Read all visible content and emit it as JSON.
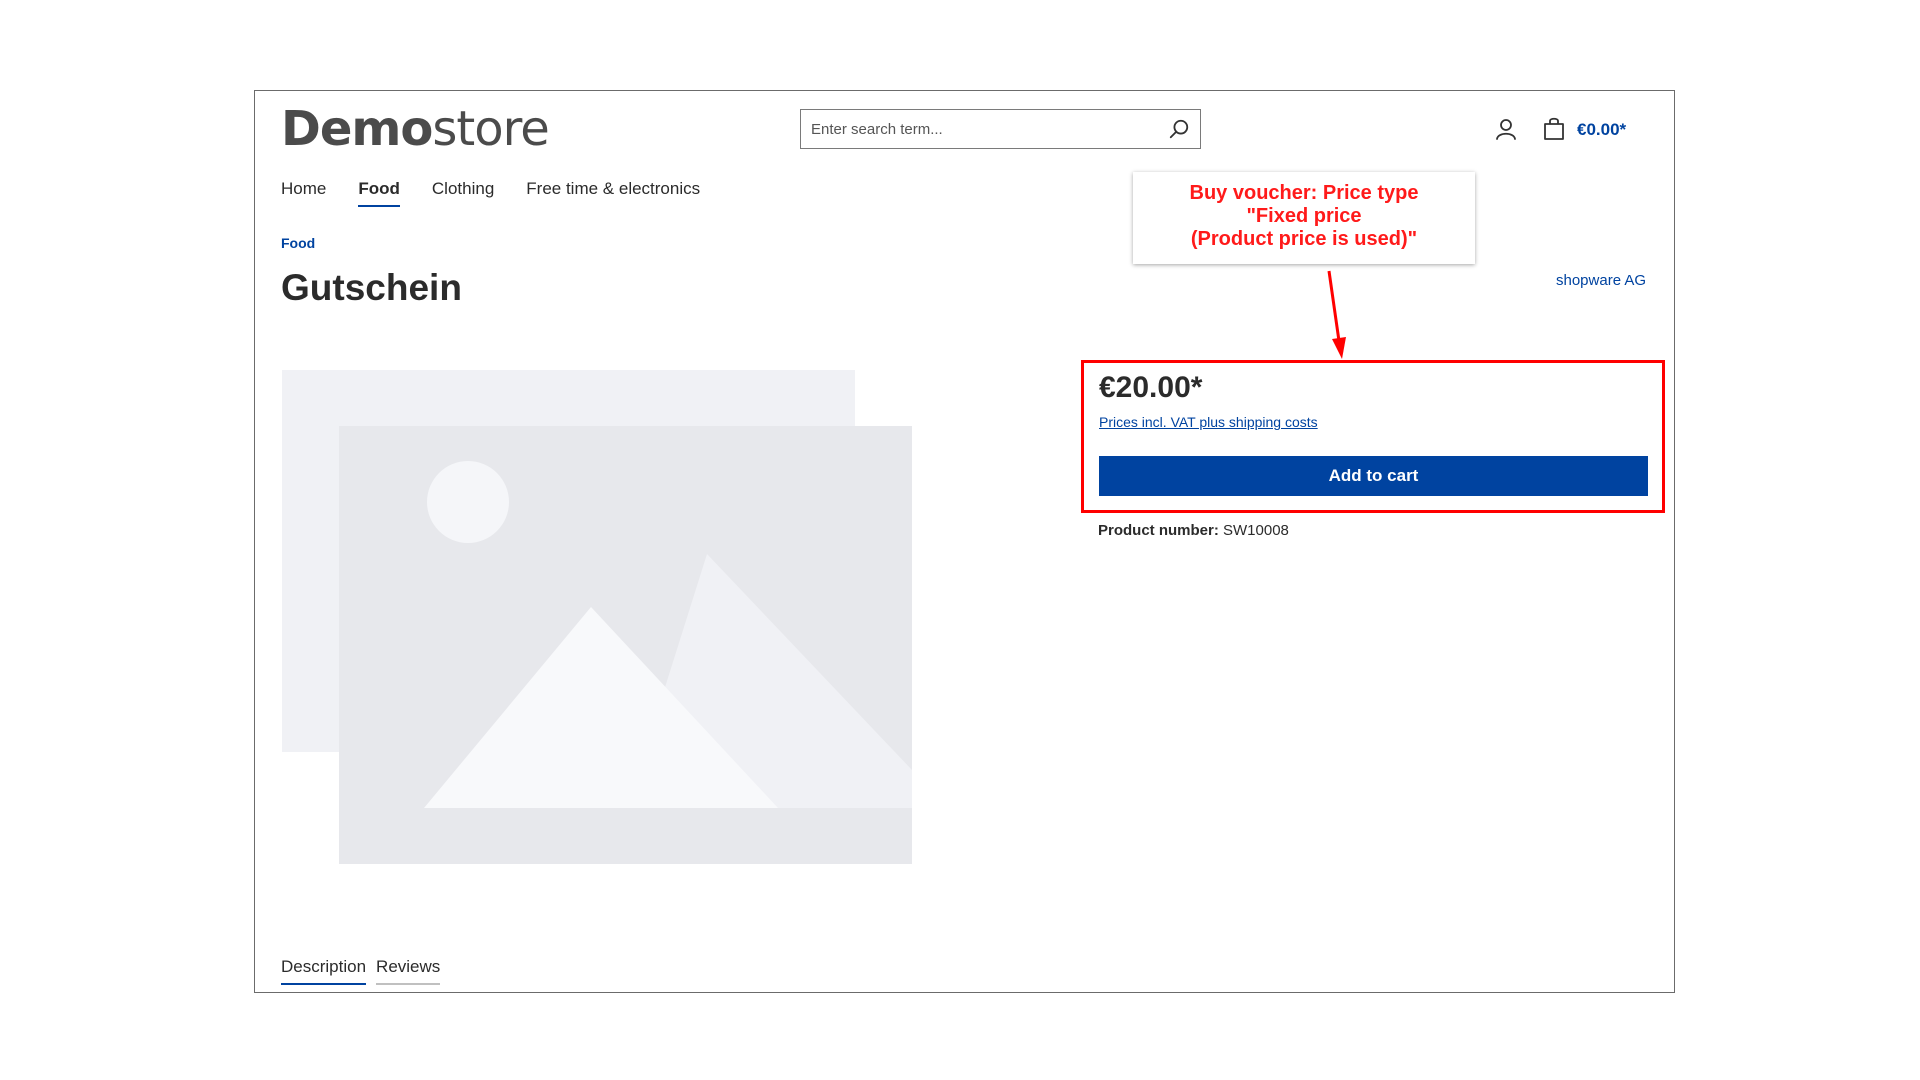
{
  "header": {
    "logo_bold": "Demo",
    "logo_light": "store",
    "search_placeholder": "Enter search term...",
    "cart_total": "€0.00*"
  },
  "nav": {
    "items": [
      {
        "label": "Home",
        "active": false
      },
      {
        "label": "Food",
        "active": true
      },
      {
        "label": "Clothing",
        "active": false
      },
      {
        "label": "Free time & electronics",
        "active": false
      }
    ]
  },
  "breadcrumb": "Food",
  "product": {
    "title": "Gutschein",
    "manufacturer": "shopware AG",
    "price": "€20.00*",
    "tax_note": "Prices incl. VAT plus shipping costs",
    "add_to_cart": "Add to cart",
    "number_label": "Product number:",
    "number_value": "SW10008"
  },
  "annotation": {
    "line1": "Buy voucher: Price type",
    "line2": "\"Fixed price",
    "line3": "(Product price is used)\""
  },
  "tabs": [
    {
      "label": "Description",
      "active": true
    },
    {
      "label": "Reviews",
      "active": false
    }
  ],
  "colors": {
    "accent": "#0043a0",
    "annotation": "#ff0000"
  }
}
